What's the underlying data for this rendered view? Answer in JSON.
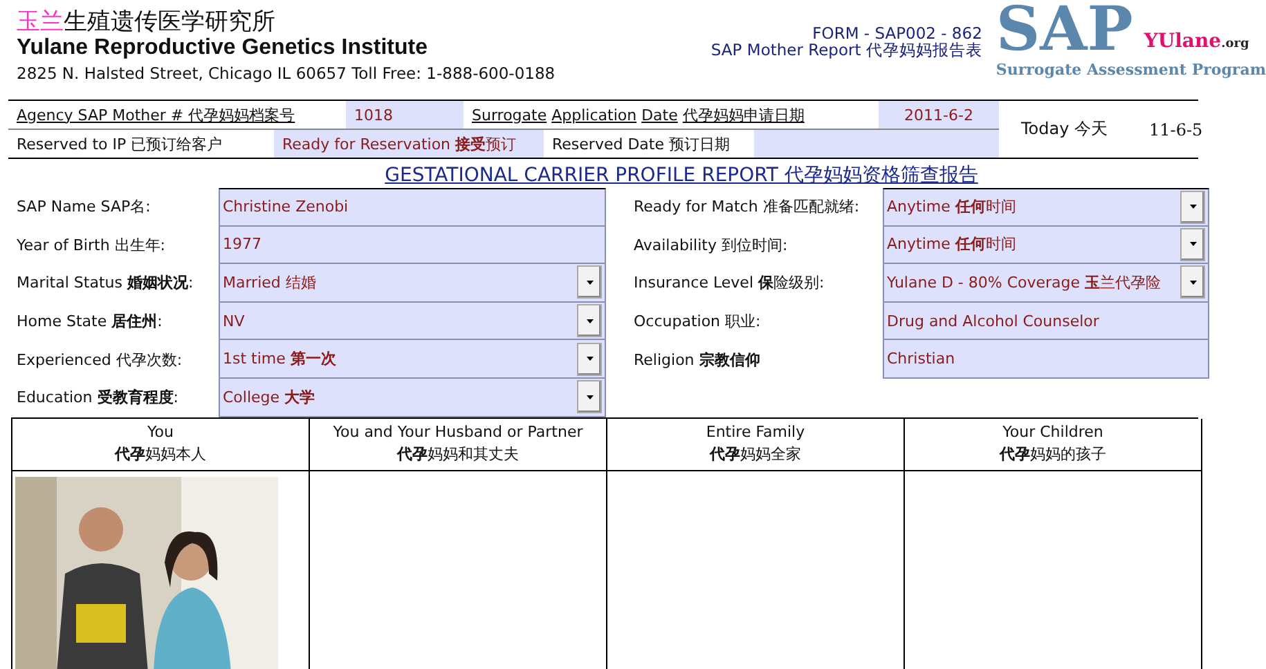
{
  "header": {
    "name_cn_accent": "玉兰",
    "name_cn": "生殖遗传医学研究所",
    "name_en": "Yulane Reproductive Genetics Institute",
    "address": "2825 N. Halsted Street, Chicago IL 60657  Toll Free: 1-888-600-0188",
    "form_code": "FORM - SAP002 - 862",
    "form_title": "SAP Mother Report 代孕妈妈报告表",
    "logo_big": "SAP",
    "logo_site": "YUlane",
    "logo_tld": ".org",
    "logo_sub": "Surrogate Assessment Program"
  },
  "info": {
    "agency_label": "Agency SAP Mother  # 代孕妈妈档案号",
    "agency_value": "1018",
    "app_label_1": "Surrogate",
    "app_label_2": "Application",
    "app_label_3": "Date",
    "app_label_cn": "代孕妈妈申请日期",
    "app_value": "2011-6-2",
    "reserved_ip_label": "Reserved to IP  已预订给客户",
    "reservation_status": "Ready for Reservation **接受**预订",
    "reserved_date_label": "Reserved Date 预订日期",
    "today_label": "Today 今天",
    "today_value": "11-6-5"
  },
  "report_title": "GESTATIONAL CARRIER PROFILE REPORT 代孕妈妈资格筛查报告",
  "left_fields": [
    {
      "label": "SAP Name SAP名:",
      "value": "Christine Zenobi",
      "kind": "text"
    },
    {
      "label": "Year of Birth 出生年:",
      "value": "1977",
      "kind": "text"
    },
    {
      "label": "Marital Status **婚姻状况**:",
      "value": "Married 结婚",
      "kind": "dropdown"
    },
    {
      "label": "Home State **居住州**:",
      "value": "NV",
      "kind": "dropdown"
    },
    {
      "label": "Experienced  代孕次数:",
      "value": "1st time  **第一次**",
      "kind": "dropdown"
    },
    {
      "label": "Education **受教育程度**:",
      "value": "College **大学**",
      "kind": "dropdown"
    }
  ],
  "right_fields": [
    {
      "label": "Ready for Match 准备匹配就绪:",
      "value": "Anytime **任何**时间",
      "kind": "dropdown"
    },
    {
      "label": "Availability 到位时间:",
      "value": "Anytime **任何**时间",
      "kind": "dropdown"
    },
    {
      "label": "Insurance Level **保**险级别:",
      "value": "Yulane D - 80% Coverage **玉**兰代孕险",
      "kind": "dropdown"
    },
    {
      "label": "Occupation 职业:",
      "value": "Drug and Alcohol Counselor",
      "kind": "text"
    },
    {
      "label": "Religion **宗教信仰**",
      "value": "Christian",
      "kind": "text"
    }
  ],
  "photo_columns": [
    {
      "title": "You",
      "subtitle": "**代孕**妈妈本人"
    },
    {
      "title": "You and Your Husband or Partner",
      "subtitle": "**代孕**妈妈和其丈夫"
    },
    {
      "title": "Entire Family",
      "subtitle": "**代孕**妈妈全家"
    },
    {
      "title": "Your Children",
      "subtitle": "**代孕**妈妈的孩子"
    }
  ]
}
